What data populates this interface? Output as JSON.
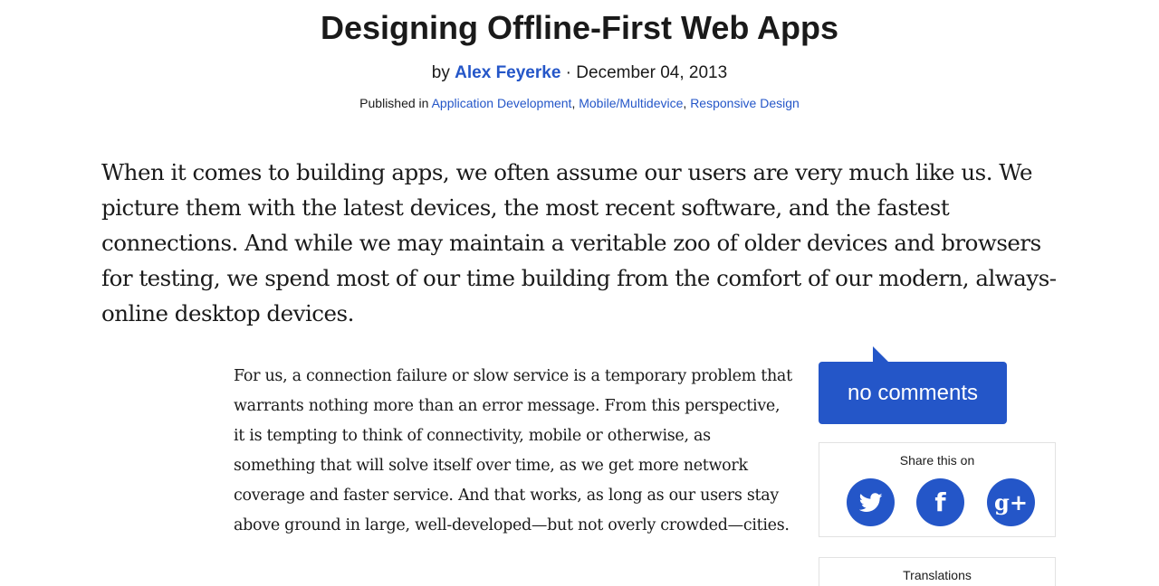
{
  "article": {
    "title": "Designing Offline-First Web Apps",
    "byline_prefix": "by ",
    "author": "Alex Feyerke",
    "date_separator": " · ",
    "date": "December 04, 2013",
    "published_prefix": "Published in ",
    "categories": [
      "Application Development",
      "Mobile/Multidevice",
      "Responsive Design"
    ],
    "category_separator": ", ",
    "intro": "When it comes to building apps, we often assume our users are very much like us. We picture them with the latest devices, the most recent software, and the fastest connections. And while we may maintain a veritable zoo of older devices and browsers for testing, we spend most of our time building from the comfort of our modern, always-online desktop devices.",
    "paragraph_1": "For us, a connection failure or slow service is a temporary problem that warrants nothing more than an error message. From this perspective, it is tempting to think of connectivity, mobile or otherwise, as something that will solve itself over time, as we get more network coverage and faster service. And that works, as long as our users stay above ground in large, well-developed—but not overly crowded—cities."
  },
  "sidebar": {
    "comments_label": "no comments",
    "share_title": "Share this on",
    "share_icons": [
      {
        "name": "twitter-icon",
        "glyph": "🐦"
      },
      {
        "name": "facebook-icon",
        "glyph": "f"
      },
      {
        "name": "google-plus-icon",
        "glyph": "g+"
      }
    ],
    "translations_title": "Translations"
  },
  "colors": {
    "accent": "#2456c8",
    "text": "#1a1a1a",
    "border": "#e2e2e2"
  }
}
